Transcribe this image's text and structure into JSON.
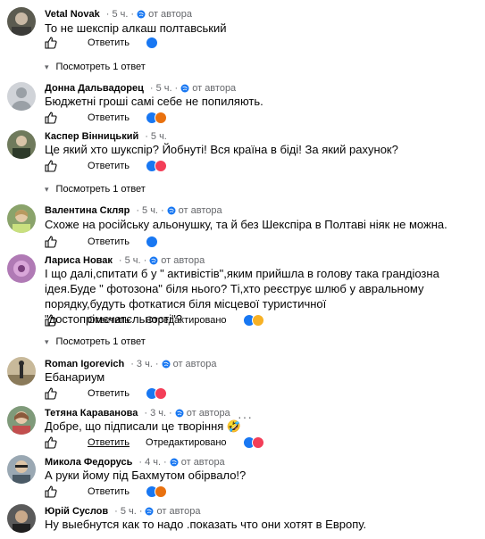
{
  "ui": {
    "like_label": "Ответить",
    "rec_label": "Отредактировано",
    "author_tag": "от автора",
    "replies_1": "Посмотреть 1 ответ",
    "more": "···"
  },
  "comments": [
    {
      "name": "Vetal Novak",
      "time": "5 ч.",
      "text": "То не шекспір алкаш полтавський"
    },
    {
      "name": "Донна Дальвадорец",
      "time": "5 ч.",
      "text": "Бюджетні гроші самі себе не попиляють."
    },
    {
      "name": "Каспер Вінницький",
      "time": "5 ч.",
      "text": "Це який хто шукспір? Йобнуті! Вся країна в біді! За який рахунок?"
    },
    {
      "name": "Валентина Скляр",
      "time": "5 ч.",
      "text": "Схоже на російську альонушку, та й без Шекспіра в Полтаві ніяк не можна."
    },
    {
      "name": "Лариса Новак",
      "time": "5 ч.",
      "text": "І що далі,спитати б у \" активістів\",яким прийшла в голову така грандіозна ідея.Буде \" фотозона\" біля нього? Ті,хто реєструє шлюб у авральному порядку,будуть фоткатися біля місцевої туристичної \"достопрімєчатєльності\"?"
    },
    {
      "name": "Roman Igorevich",
      "time": "3 ч.",
      "text": "Ебанариум"
    },
    {
      "name": "Тетяна Караванова",
      "time": "3 ч.",
      "text": "Добре, що підписали це творіння 🤣"
    },
    {
      "name": "Микола Федорусь",
      "time": "4 ч.",
      "text": "А руки йому під Бахмутом обірвало!?"
    },
    {
      "name": "Юрій Суслов",
      "time": "5 ч.",
      "text": "Ну выебнутся как то надо .показать что они хотят в Европу."
    }
  ],
  "colors": {
    "like_blue": "#1877f2",
    "haha_yellow": "#f7b125",
    "angry": "#e9710f",
    "love_red": "#f33e58",
    "meta_grey": "#65676b"
  }
}
